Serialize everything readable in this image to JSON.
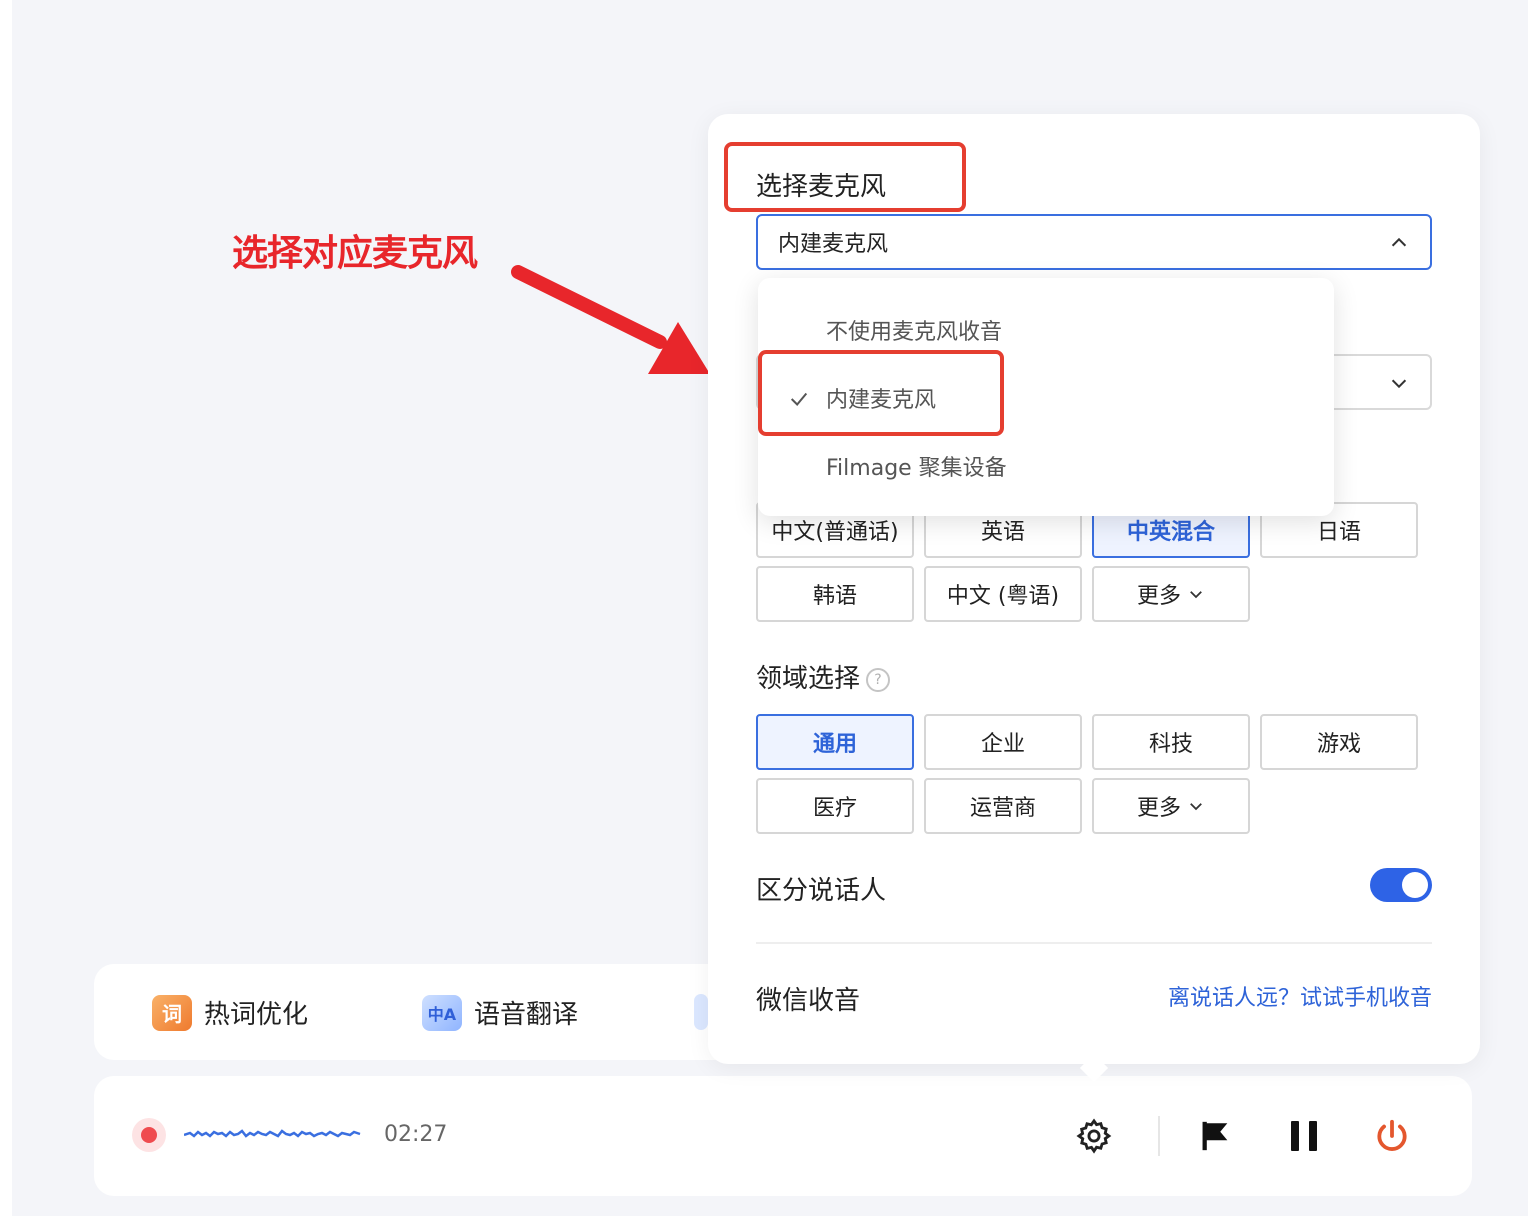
{
  "annotation": {
    "text": "选择对应麦克风",
    "color": "#e8262b"
  },
  "feature_strip": {
    "items": [
      {
        "icon": "hot-word-icon",
        "icon_glyph": "词",
        "label": "热词优化"
      },
      {
        "icon": "translate-icon",
        "icon_glyph": "中A",
        "label": "语音翻译"
      }
    ]
  },
  "recording": {
    "time": "02:27",
    "status_color": "#ef4b4f",
    "controls": [
      "gear-icon",
      "flag-icon",
      "pause-icon",
      "power-icon"
    ]
  },
  "panel": {
    "microphone": {
      "title": "选择麦克风",
      "selected": "内建麦克风",
      "options": [
        {
          "label": "不使用麦克风收音",
          "checked": false
        },
        {
          "label": "内建麦克风",
          "checked": true
        },
        {
          "label": "Filmage 聚集设备",
          "checked": false
        }
      ]
    },
    "languages": {
      "options": [
        "中文(普通话)",
        "英语",
        "中英混合",
        "日语",
        "韩语",
        "中文 (粤语)",
        "更多"
      ],
      "selected": "中英混合"
    },
    "domain": {
      "title": "领域选择",
      "help": "?",
      "options": [
        "通用",
        "企业",
        "科技",
        "游戏",
        "医疗",
        "运营商",
        "更多"
      ],
      "selected": "通用"
    },
    "speaker": {
      "title": "区分说话人",
      "enabled": true
    },
    "wechat": {
      "title": "微信收音",
      "link": "离说话人远？试试手机收音"
    },
    "accent_color": "#2e63d8"
  }
}
